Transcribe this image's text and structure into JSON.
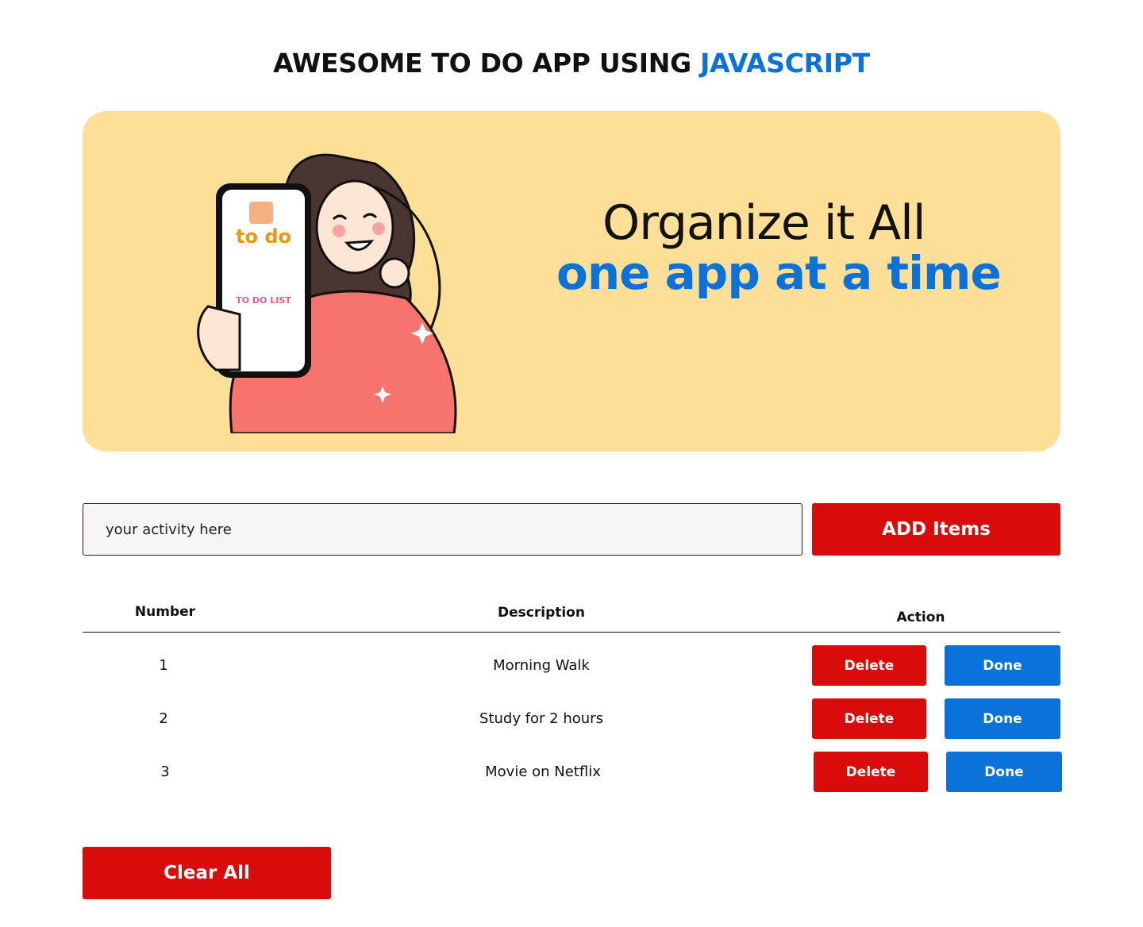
{
  "header": {
    "title_main": "AWESOME TO DO APP USING ",
    "title_accent": "JAVASCRIPT"
  },
  "banner": {
    "line1": "Organize it All",
    "line2": "one app at a time",
    "phone_label": "to do",
    "phone_sublabel": "TO DO LIST"
  },
  "form": {
    "input_placeholder": "your activity here",
    "input_value": "",
    "add_button_label": "ADD Items"
  },
  "table": {
    "headers": {
      "number": "Number",
      "description": "Description",
      "action": "Action"
    },
    "rows": [
      {
        "number": "1",
        "description": "Morning Walk",
        "delete_label": "Delete",
        "done_label": "Done"
      },
      {
        "number": "2",
        "description": "Study for 2 hours",
        "delete_label": "Delete",
        "done_label": "Done"
      },
      {
        "number": "3",
        "description": "Movie on Netflix",
        "delete_label": "Delete",
        "done_label": "Done"
      }
    ]
  },
  "footer": {
    "clear_button_label": "Clear All"
  },
  "colors": {
    "accent_blue": "#0b72d9",
    "action_red": "#d90b0b",
    "banner_bg": "#fedf97"
  }
}
